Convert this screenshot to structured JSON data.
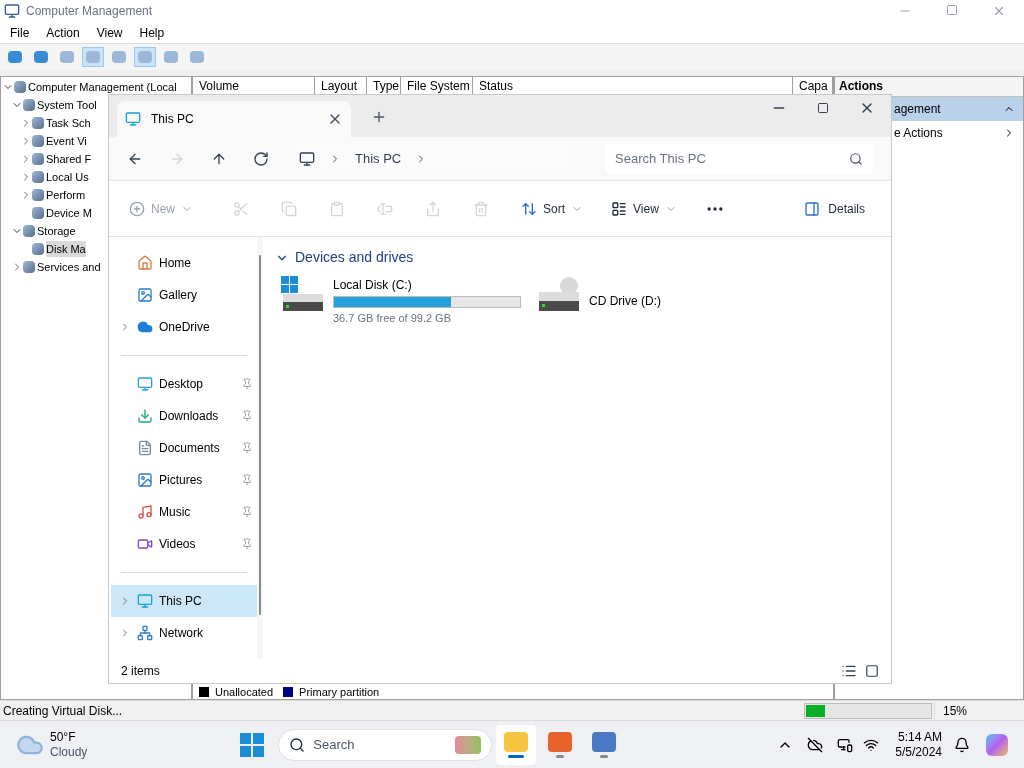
{
  "cm": {
    "title": "Computer Management",
    "menu": [
      "File",
      "Action",
      "View",
      "Help"
    ],
    "toolbar": [
      {
        "pressed": false
      },
      {
        "pressed": false
      },
      {
        "pressed": false
      },
      {
        "pressed": true
      },
      {
        "pressed": false
      },
      {
        "pressed": true
      },
      {
        "pressed": false
      },
      {
        "pressed": false
      }
    ],
    "tree": [
      {
        "label": "Computer Management (Local",
        "selected": false,
        "expanded": true,
        "children": [
          {
            "label": "System Tool",
            "selected": false,
            "expanded": true,
            "children": [
              {
                "label": "Task Sch",
                "selected": false,
                "expanded": false
              },
              {
                "label": "Event Vi",
                "selected": false,
                "expanded": false
              },
              {
                "label": "Shared F",
                "selected": false,
                "expanded": false
              },
              {
                "label": "Local Us",
                "selected": false,
                "expanded": false
              },
              {
                "label": "Perform",
                "selected": false,
                "expanded": false
              },
              {
                "label": "Device M",
                "selected": false
              }
            ]
          },
          {
            "label": "Storage",
            "selected": false,
            "expanded": true,
            "children": [
              {
                "label": "Disk Ma",
                "selected": true
              }
            ]
          },
          {
            "label": "Services and",
            "selected": false,
            "expanded": false
          }
        ]
      }
    ],
    "columns": [
      "Volume",
      "Layout",
      "Type",
      "File System",
      "Status",
      "Capa"
    ],
    "legend": [
      {
        "label": "Unallocated",
        "color": "#000000"
      },
      {
        "label": "Primary partition",
        "color": "#000080"
      }
    ],
    "actions": {
      "header": "Actions",
      "items": [
        {
          "label": "agement",
          "kind": "section"
        },
        {
          "label": "e Actions",
          "kind": "submenu"
        }
      ]
    },
    "status": {
      "text": "Creating Virtual Disk...",
      "level": 0.15,
      "reading": "15%"
    }
  },
  "explorer": {
    "tab": "This PC",
    "breadcrumb": [
      "This PC"
    ],
    "search": {
      "placeholder": "Search This PC"
    },
    "command_bar": {
      "new": {
        "label": "New",
        "disabled": true
      },
      "icon_buttons": [
        {
          "disabled": true
        },
        {
          "disabled": true
        },
        {
          "disabled": true
        },
        {
          "disabled": true
        },
        {
          "disabled": true
        },
        {
          "disabled": true
        }
      ],
      "sort": "Sort",
      "view": "View",
      "details": "Details"
    },
    "nav": [
      [
        {
          "label": "Home",
          "has_children": false,
          "pinned": false,
          "selected": false
        },
        {
          "label": "Gallery",
          "has_children": false,
          "pinned": false,
          "selected": false
        },
        {
          "label": "OneDrive",
          "has_children": true,
          "pinned": false,
          "selected": false
        }
      ],
      [
        {
          "label": "Desktop",
          "has_children": false,
          "pinned": true,
          "selected": false
        },
        {
          "label": "Downloads",
          "has_children": false,
          "pinned": true,
          "selected": false
        },
        {
          "label": "Documents",
          "has_children": false,
          "pinned": true,
          "selected": false
        },
        {
          "label": "Pictures",
          "has_children": false,
          "pinned": true,
          "selected": false
        },
        {
          "label": "Music",
          "has_children": false,
          "pinned": true,
          "selected": false
        },
        {
          "label": "Videos",
          "has_children": false,
          "pinned": true,
          "selected": false
        }
      ],
      [
        {
          "label": "This PC",
          "has_children": true,
          "pinned": false,
          "selected": true
        },
        {
          "label": "Network",
          "has_children": true,
          "pinned": false,
          "selected": false
        }
      ]
    ],
    "group": {
      "title": "Devices and drives",
      "expanded": true
    },
    "drives": [
      {
        "kind": "disk",
        "name": "Local Disk (C:)",
        "level": 0.63,
        "free": "36.7 GB free of 99.2 GB"
      },
      {
        "kind": "cd",
        "name": "CD Drive (D:)"
      }
    ],
    "status": "2 items"
  },
  "taskbar": {
    "weather": {
      "temp": "50°F",
      "desc": "Cloudy"
    },
    "search": {
      "placeholder": "Search"
    },
    "apps": [
      {
        "active": true,
        "running": true
      },
      {
        "active": false,
        "running": true
      },
      {
        "active": false,
        "running": true
      }
    ],
    "time": "5:14 AM",
    "date": "5/5/2024"
  }
}
